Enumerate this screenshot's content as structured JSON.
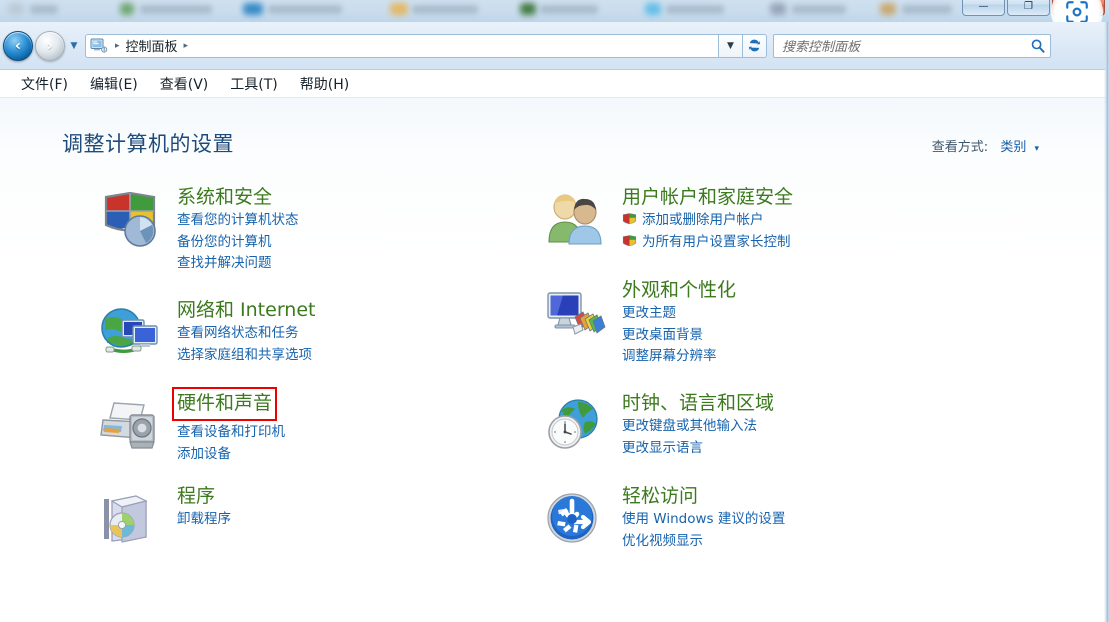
{
  "window": {
    "controls": [
      {
        "name": "minimize",
        "glyph": "—"
      },
      {
        "name": "maximize",
        "glyph": "❐"
      },
      {
        "name": "close",
        "glyph": "✕"
      }
    ],
    "overlay_icon": "camera-capture-icon"
  },
  "navigation": {
    "back_label": "‹",
    "forward_label": "›",
    "history_dropdown": "▼",
    "breadcrumb_icon": "control-panel-icon",
    "breadcrumb": [
      "控制面板"
    ],
    "breadcrumb_separator": "▸",
    "address_dropdown": "▼",
    "refresh_label": "↻"
  },
  "search": {
    "placeholder": "搜索控制面板",
    "value": "",
    "icon": "search-icon"
  },
  "menubar": {
    "items": [
      {
        "label": "文件(F)"
      },
      {
        "label": "编辑(E)"
      },
      {
        "label": "查看(V)"
      },
      {
        "label": "工具(T)"
      },
      {
        "label": "帮助(H)"
      }
    ]
  },
  "content": {
    "title": "调整计算机的设置",
    "view_by": {
      "label": "查看方式:",
      "value": "类别",
      "caret": "▾"
    }
  },
  "categories": {
    "left": [
      {
        "id": "system-and-security",
        "icon": "security-shield-icon",
        "title": "系统和安全",
        "highlighted": false,
        "links": [
          {
            "label": "查看您的计算机状态",
            "shield": false
          },
          {
            "label": "备份您的计算机",
            "shield": false
          },
          {
            "label": "查找并解决问题",
            "shield": false
          }
        ]
      },
      {
        "id": "network-and-internet",
        "icon": "network-globe-icon",
        "title": "网络和 Internet",
        "highlighted": false,
        "links": [
          {
            "label": "查看网络状态和任务",
            "shield": false
          },
          {
            "label": "选择家庭组和共享选项",
            "shield": false
          }
        ]
      },
      {
        "id": "hardware-and-sound",
        "icon": "printer-icon",
        "title": "硬件和声音",
        "highlighted": true,
        "links": [
          {
            "label": "查看设备和打印机",
            "shield": false
          },
          {
            "label": "添加设备",
            "shield": false
          }
        ]
      },
      {
        "id": "programs",
        "icon": "programs-box-icon",
        "title": "程序",
        "highlighted": false,
        "links": [
          {
            "label": "卸载程序",
            "shield": false
          }
        ]
      }
    ],
    "right": [
      {
        "id": "user-accounts-and-family-safety",
        "icon": "users-icon",
        "title": "用户帐户和家庭安全",
        "highlighted": false,
        "links": [
          {
            "label": "添加或删除用户帐户",
            "shield": true
          },
          {
            "label": "为所有用户设置家长控制",
            "shield": true
          }
        ]
      },
      {
        "id": "appearance-and-personalization",
        "icon": "monitor-palette-icon",
        "title": "外观和个性化",
        "highlighted": false,
        "links": [
          {
            "label": "更改主题",
            "shield": false
          },
          {
            "label": "更改桌面背景",
            "shield": false
          },
          {
            "label": "调整屏幕分辨率",
            "shield": false
          }
        ]
      },
      {
        "id": "clock-language-and-region",
        "icon": "globe-clock-icon",
        "title": "时钟、语言和区域",
        "highlighted": false,
        "links": [
          {
            "label": "更改键盘或其他输入法",
            "shield": false
          },
          {
            "label": "更改显示语言",
            "shield": false
          }
        ]
      },
      {
        "id": "ease-of-access",
        "icon": "ease-of-access-icon",
        "title": "轻松访问",
        "highlighted": false,
        "links": [
          {
            "label": "使用 Windows 建议的设置",
            "shield": false
          },
          {
            "label": "优化视频显示",
            "shield": false
          }
        ]
      }
    ]
  },
  "colors": {
    "category_title": "#3c7a1e",
    "link": "#1763ad",
    "page_title": "#1f4b7a",
    "highlight_box": "#ee0000"
  }
}
